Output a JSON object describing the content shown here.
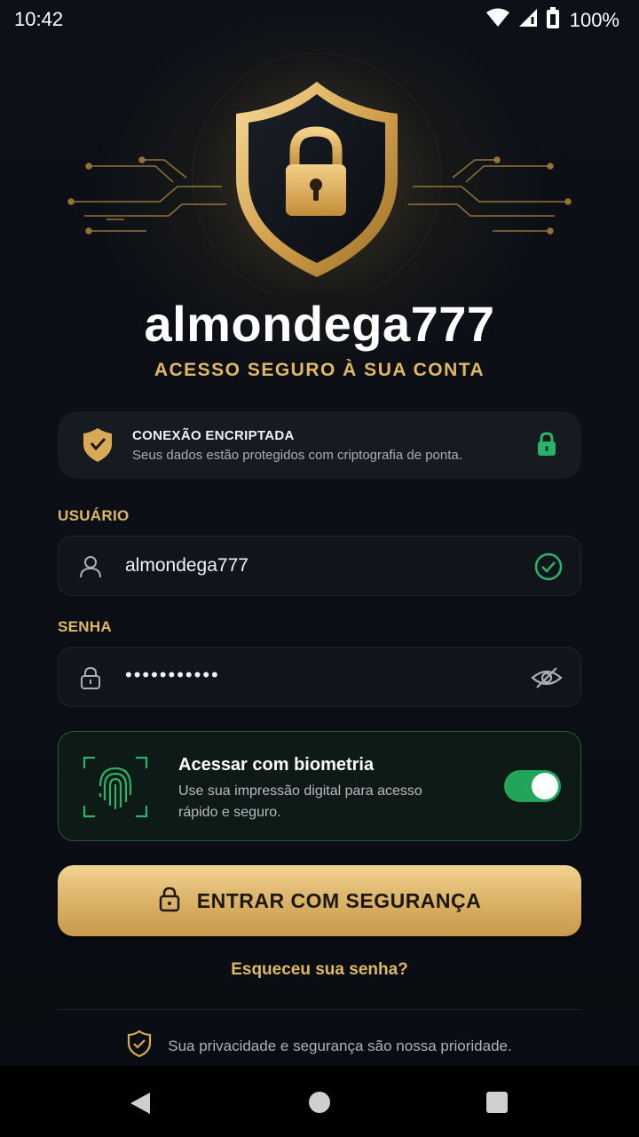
{
  "status_bar": {
    "time": "10:42",
    "battery": "100%",
    "icons": [
      "wifi-icon",
      "signal-icon",
      "battery-icon"
    ]
  },
  "hero": {
    "icons": [
      "shield-icon",
      "padlock-icon",
      "circuit-lines"
    ]
  },
  "app": {
    "name": "almondega777",
    "subtitle": "ACESSO SEGURO À SUA CONTA"
  },
  "encryption_card": {
    "title": "CONEXÃO ENCRIPTADA",
    "description": "Seus dados estão protegidos com criptografia de ponta.",
    "icons": [
      "shield-check-icon",
      "lock-icon"
    ]
  },
  "username": {
    "label": "USUÁRIO",
    "value": "almondega777",
    "icons": [
      "user-icon",
      "check-circle-icon"
    ]
  },
  "password": {
    "label": "SENHA",
    "masked_value": "•••••••••••",
    "icons": [
      "lock-icon",
      "eye-off-icon"
    ]
  },
  "biometrics": {
    "title": "Acessar com biometria",
    "description": "Use sua impressão digital para acesso rápido e seguro.",
    "enabled": true,
    "icons": [
      "fingerprint-icon"
    ]
  },
  "login_button": {
    "label": "ENTRAR COM SEGURANÇA",
    "icon": "lock-icon"
  },
  "forgot_password": "Esqueceu sua senha?",
  "privacy_note": "Sua privacidade e segurança são nossa prioridade.",
  "navigation": {
    "buttons": [
      "back",
      "home",
      "recents"
    ]
  },
  "colors": {
    "background": "#0b0f15",
    "accent_gold": "#e0b865",
    "success_green": "#22a55b",
    "card": "#161b22"
  }
}
